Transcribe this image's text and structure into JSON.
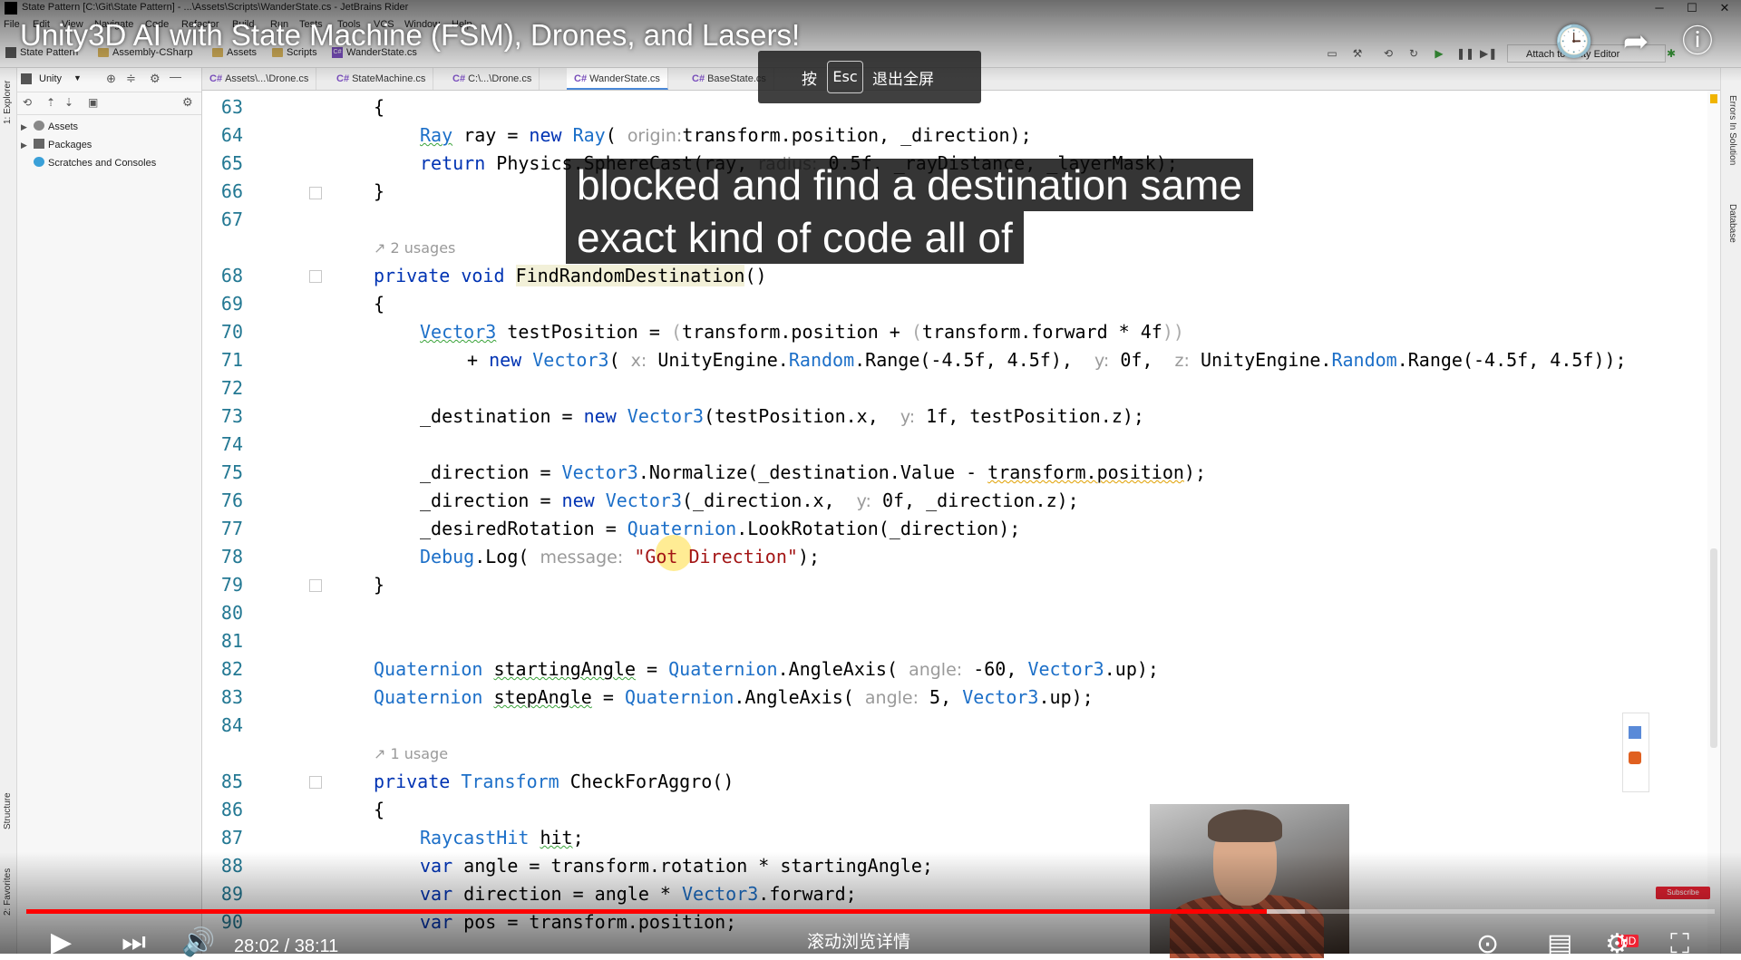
{
  "window": {
    "title": "State Pattern [C:\\Git\\State Pattern] - ...\\Assets\\Scripts\\WanderState.cs - JetBrains Rider"
  },
  "menu": [
    "File",
    "Edit",
    "View",
    "Navigate",
    "Code",
    "Refactor",
    "Build",
    "Run",
    "Tests",
    "Tools",
    "VCS",
    "Window",
    "Help"
  ],
  "breadcrumb": [
    "State Pattern",
    "Assembly-CSharp",
    "Assets",
    "Scripts",
    "WanderState.cs"
  ],
  "toolbar": {
    "attach_label": "Attach to Unity Editor"
  },
  "explorer": {
    "mode": "Unity",
    "tree": [
      "Assets",
      "Packages",
      "Scratches and Consoles"
    ]
  },
  "left_strip": {
    "explorer": "1: Explorer",
    "structure": "Structure",
    "favorites": "2: Favorites"
  },
  "right_strip": {
    "errors": "Errors In Solution",
    "database": "Database"
  },
  "tabs": [
    {
      "label": "Assets\\...\\Drone.cs"
    },
    {
      "label": "StateMachine.cs"
    },
    {
      "label": "C:\\...\\Drone.cs"
    },
    {
      "label": "WanderState.cs"
    },
    {
      "label": "BaseState.cs"
    }
  ],
  "code": {
    "line_numbers": [
      "63",
      "64",
      "65",
      "66",
      "67",
      "68",
      "69",
      "70",
      "71",
      "72",
      "73",
      "74",
      "75",
      "76",
      "77",
      "78",
      "79",
      "80",
      "81",
      "82",
      "83",
      "84",
      "85",
      "86",
      "87",
      "88",
      "89",
      "90"
    ],
    "usages_68": "2 usages",
    "usages_85": "1 usage",
    "lines": {
      "l63": "{",
      "l64_a": "Ray",
      "l64_b": " ray = ",
      "l64_c": "new",
      "l64_d": " ",
      "l64_e": "Ray",
      "l64_f": "( ",
      "l64_h": "origin:",
      "l64_g": "transform.position, _direction);",
      "l65_a": "return",
      "l65_b": " Physics.SphereCast(ray, ",
      "l65_h": "radius:",
      "l65_c": " 0.5f, _rayDistance, _layerMask);",
      "l66": "}",
      "l68_a": "private",
      "l68_b": " ",
      "l68_c": "void",
      "l68_d": " ",
      "l68_e": "FindRandomDestination",
      "l68_f": "()",
      "l69": "{",
      "l70_a": "Vector3",
      "l70_b": " testPosition = ",
      "l70_p1": "(",
      "l70_c": "transform.position + ",
      "l70_p2": "(",
      "l70_d": "transform.forward * 4f",
      "l70_p3": "))",
      "l71_a": "+ ",
      "l71_b": "new",
      "l71_c": " ",
      "l71_d": "Vector3",
      "l71_e": "( ",
      "l71_hx": "x:",
      "l71_f": " UnityEngine.",
      "l71_g": "Random",
      "l71_h": ".Range(-4.5f, 4.5f),  ",
      "l71_hy": "y:",
      "l71_i": " 0f,  ",
      "l71_hz": "z:",
      "l71_j": " UnityEngine.",
      "l71_k": "Random",
      "l71_l": ".Range(-4.5f, 4.5f));",
      "l73_a": "_destination = ",
      "l73_b": "new",
      "l73_c": " ",
      "l73_d": "Vector3",
      "l73_e": "(testPosition.x,  ",
      "l73_hy": "y:",
      "l73_f": " 1f, testPosition.z);",
      "l75_a": "_direction = ",
      "l75_b": "Vector3",
      "l75_c": ".Normalize(_destination.Value - ",
      "l75_d": "transform.position",
      "l75_e": ");",
      "l76_a": "_direction = ",
      "l76_b": "new",
      "l76_c": " ",
      "l76_d": "Vector3",
      "l76_e": "(_direction.x,  ",
      "l76_hy": "y:",
      "l76_f": " 0f, _direction.z);",
      "l77_a": "_desiredRotation = ",
      "l77_b": "Quaternion",
      "l77_c": ".LookRotation(_direction);",
      "l78_a": "Debug",
      "l78_b": ".Log( ",
      "l78_h": "message:",
      "l78_c": " ",
      "l78_d": "\"Got Direction\"",
      "l78_e": ");",
      "l79": "}",
      "l82_a": "Quaternion",
      "l82_b": " ",
      "l82_c": "startingAngle",
      "l82_d": " = ",
      "l82_e": "Quaternion",
      "l82_f": ".AngleAxis( ",
      "l82_h": "angle:",
      "l82_g": " -60, ",
      "l82_i": "Vector3",
      "l82_j": ".up);",
      "l83_a": "Quaternion",
      "l83_b": " ",
      "l83_c": "stepAngle",
      "l83_d": " = ",
      "l83_e": "Quaternion",
      "l83_f": ".AngleAxis( ",
      "l83_h": "angle:",
      "l83_g": " 5, ",
      "l83_i": "Vector3",
      "l83_j": ".up);",
      "l85_a": "private",
      "l85_b": " ",
      "l85_c": "Transform",
      "l85_d": " CheckForAggro()",
      "l86": "{",
      "l87_a": "RaycastHit",
      "l87_b": " ",
      "l87_c": "hit",
      "l87_d": ";",
      "l88_a": "var",
      "l88_b": " angle = transform.rotation * startingAngle;",
      "l89_a": "var",
      "l89_b": " direction = angle * ",
      "l89_c": "Vector3",
      "l89_d": ".forward;",
      "l90_a": "var",
      "l90_b": " pos = transform.position;"
    }
  },
  "overlay": {
    "video_title": "Unity3D AI with State Machine (FSM), Drones, and Lasers!",
    "esc_prefix": "按",
    "esc_key": "Esc",
    "esc_suffix": "退出全屏",
    "caption_line1": "blocked and find a destination same",
    "caption_line2": "exact kind of code all of",
    "time": "28:02 / 38:11",
    "scroll_hint": "滚动浏览详情",
    "progress_fraction": 0.7345,
    "buffer_fraction": 0.757,
    "subscribe_badge": "Subscribe",
    "hd_badge": "HD"
  },
  "colors": {
    "keyword": "#0033b3",
    "type": "#1c6fc8",
    "string": "#a31515",
    "line_number": "#237893",
    "progress": "#ff0000"
  }
}
